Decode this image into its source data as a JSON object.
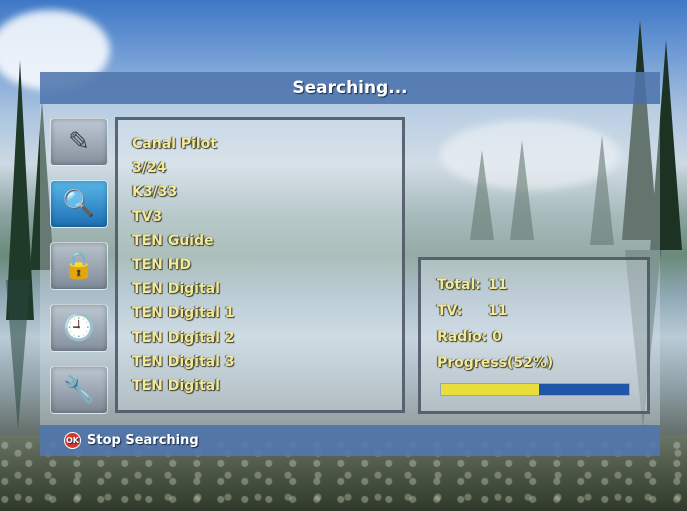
{
  "title": "Searching...",
  "sidebar": {
    "icons": [
      {
        "name": "satellite-dish-icon",
        "glyph": "✎",
        "active": false
      },
      {
        "name": "search-icon",
        "glyph": "🔍",
        "active": true
      },
      {
        "name": "lock-icon",
        "glyph": "🔒",
        "active": false
      },
      {
        "name": "clock-icon",
        "glyph": "🕘",
        "active": false
      },
      {
        "name": "tools-icon",
        "glyph": "🔧",
        "active": false
      }
    ]
  },
  "channels": [
    "Canal Pilot",
    "3/24",
    "K3/33",
    "TV3",
    "TEN Guide",
    "TEN HD",
    "TEN Digital",
    "TEN Digital 1",
    "TEN Digital 2",
    "TEN Digital 3",
    "TEN Digital"
  ],
  "info": {
    "total_label": "Total:",
    "total_value": "11",
    "tv_label": "TV:",
    "tv_value": "11",
    "radio_label": "Radio:",
    "radio_value": "0",
    "progress_label": "Progress(52%)",
    "progress_fraction": 0.52
  },
  "footer": {
    "ok_badge": "OK",
    "stop_label": "Stop Searching"
  },
  "colors": {
    "text": "#f2ea9a",
    "progress_fill": "#e8df3a",
    "progress_track": "#1f56a8",
    "bar": "#466eaa"
  }
}
